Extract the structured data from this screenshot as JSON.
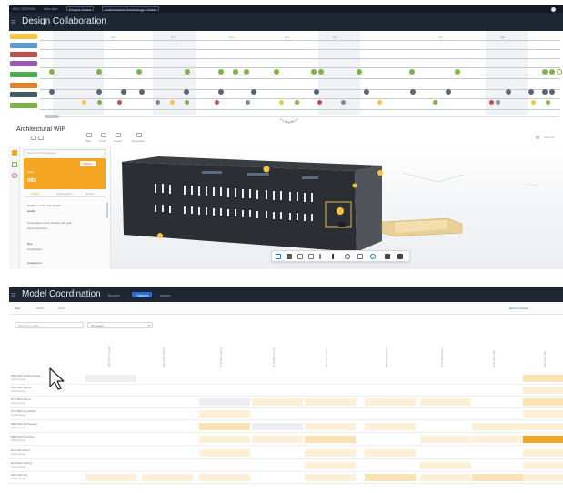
{
  "design": {
    "breadcrumbs": [
      "ACC DESIGN",
      "Alex Ash",
      "Project Name",
      "Autonomous Technology Center"
    ],
    "title": "Design Collaboration",
    "menu_icon": "hamburger-icon",
    "colors": {
      "header": "#1e2533",
      "accent": "#f4a623",
      "green": "#7cb342",
      "gray": "#6b7280"
    },
    "column_headers": [
      "Sep",
      "Oct",
      "Nov",
      "Dec",
      "Jan",
      "Feb",
      "Mar"
    ],
    "row_label_colors": [
      "#f4c542",
      "#5b9bd5",
      "#c0504d",
      "#9b59b6",
      "#4caf50",
      "#e67e22",
      "#455a64",
      "#7cb342"
    ]
  },
  "viewer": {
    "panel_title": "Architectural WIP",
    "toolbar_labels": [
      "Pkgs",
      "Tools",
      "Issues",
      "Properties"
    ],
    "search_placeholder": "Search for this package",
    "card_kind": "Issue",
    "card_id": "#93",
    "card_button": "Actions",
    "tabs": [
      "Details",
      "Attachments",
      "Activity"
    ],
    "detail_lines": [
      "Confirm curtain wall support",
      "details"
    ],
    "detail_body": [
      "Coordinate Level 3 framing with wall",
      "panel at grid line."
    ],
    "field_label": "Due",
    "field_value": "Unassigned",
    "field_label_2": "Assigned to",
    "view_button": "Show all"
  },
  "coordination": {
    "title": "Model Coordination",
    "tabs": [
      "Models",
      "Clashes",
      "Issues"
    ],
    "sub_tabs": [
      "Grid",
      "Matrix",
      "Views"
    ],
    "filter_placeholder": "Search by model",
    "filter_select": "All models",
    "right_link": "Export to Excel",
    "column_headers": [
      "ARC-001 Facade",
      "ARC-002 Interior",
      "STR-001 Frame",
      "STR-002 Found",
      "MEP-001 Mech",
      "MEP-002 Plumb",
      "ELE-001 Power",
      "ELE-002 Light",
      "ARC-003 Site"
    ],
    "rows": [
      {
        "label": "ARC-001 Model Facade",
        "sub": "Clash group"
      },
      {
        "label": "ARC-002 Interior",
        "sub": "Clash group"
      },
      {
        "label": "STR-001 Frame",
        "sub": "Clash group"
      },
      {
        "label": "STR-002 Foundation",
        "sub": "Clash group"
      },
      {
        "label": "MEP-001 Mechanical",
        "sub": "Clash group"
      },
      {
        "label": "MEP-002 Plumbing",
        "sub": "Clash group"
      },
      {
        "label": "ELE-001 Power",
        "sub": "Clash group"
      },
      {
        "label": "ELE-002 Lighting",
        "sub": "Clash group"
      },
      {
        "label": "ARC-003 Site",
        "sub": "Clash group"
      }
    ]
  }
}
